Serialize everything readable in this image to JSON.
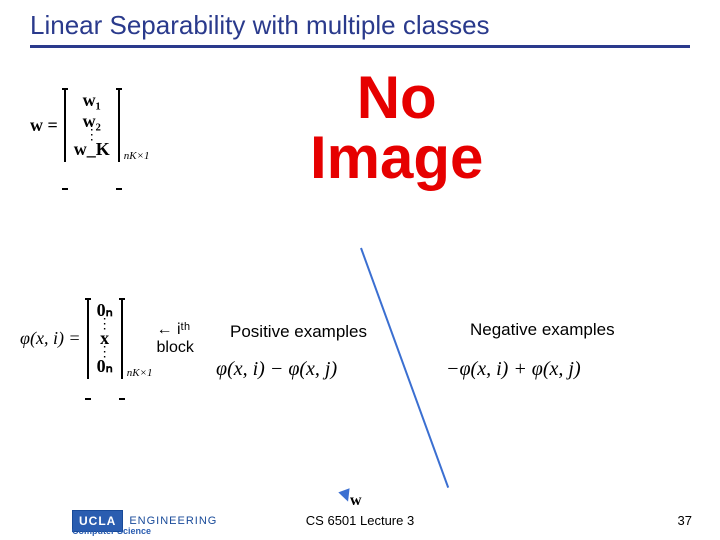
{
  "title": "Linear Separability with multiple classes",
  "w_def": {
    "lhs": "w =",
    "rows": [
      "w₁",
      "w₂",
      "⋮",
      "w_K"
    ],
    "dim": "nK×1"
  },
  "no_image_line1": "No",
  "no_image_line2": "Image",
  "phi_def": {
    "lhs": "φ(x, i) =",
    "rows": [
      "0ₙ",
      "⋮",
      "x",
      "⋮",
      "0ₙ"
    ],
    "dim": "nK×1",
    "arrow": "← iᵗʰ",
    "block": "block"
  },
  "axis_label": "w",
  "pos_heading": "Positive examples",
  "neg_heading": "Negative examples",
  "pos_expr": "φ(x, i) − φ(x, j)",
  "neg_expr": "−φ(x, i) + φ(x, j)",
  "footer": {
    "ucla": "UCLA",
    "eng": "ENGINEERING",
    "cs": "Computer Science",
    "lecture": "CS 6501 Lecture 3",
    "page": "37"
  }
}
